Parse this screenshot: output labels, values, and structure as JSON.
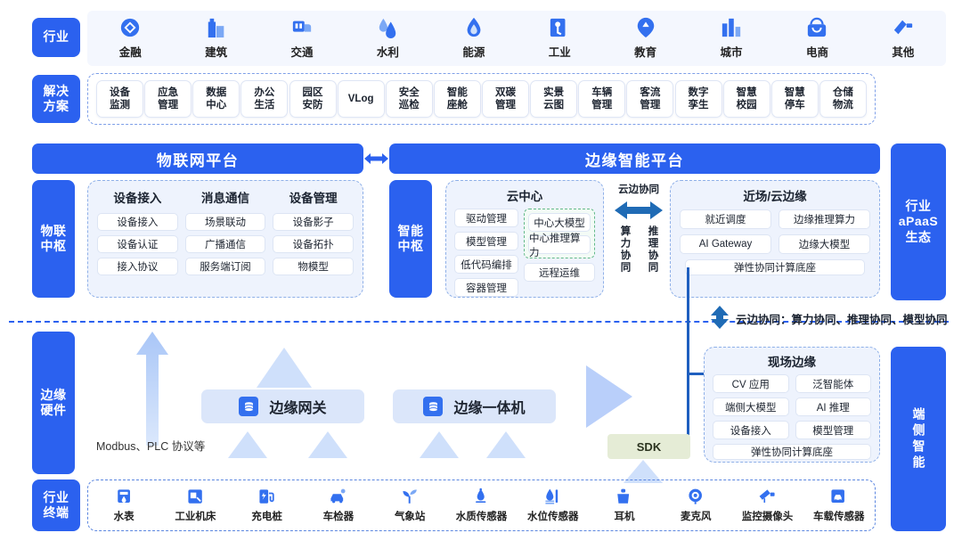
{
  "side_labels": {
    "industry": "行业",
    "solution": "解决\n方案",
    "iot_hub": "物联\n中枢",
    "ai_hub": "智能\n中枢",
    "edge_hardware": "边缘\n硬件",
    "industry_terminal": "行业\n终端",
    "apaas_ecosystem": "行业\naPaaS\n生态",
    "device_intelligence": "端侧智能"
  },
  "industry": {
    "items": [
      {
        "label": "金融",
        "icon": "finance-icon"
      },
      {
        "label": "建筑",
        "icon": "building-icon"
      },
      {
        "label": "交通",
        "icon": "transport-icon"
      },
      {
        "label": "水利",
        "icon": "water-icon"
      },
      {
        "label": "能源",
        "icon": "energy-icon"
      },
      {
        "label": "工业",
        "icon": "industry-icon"
      },
      {
        "label": "教育",
        "icon": "education-icon"
      },
      {
        "label": "城市",
        "icon": "city-icon"
      },
      {
        "label": "电商",
        "icon": "ecommerce-icon"
      },
      {
        "label": "其他",
        "icon": "other-icon"
      }
    ]
  },
  "solutions": {
    "items": [
      "设备\n监测",
      "应急\n管理",
      "数据\n中心",
      "办公\n生活",
      "园区\n安防",
      "VLog",
      "安全\n巡检",
      "智能\n座舱",
      "双碳\n管理",
      "实景\n云图",
      "车辆\n管理",
      "客流\n管理",
      "数字\n孪生",
      "智慧\n校园",
      "智慧\n停车",
      "仓储\n物流"
    ]
  },
  "platforms": {
    "iot": "物联网平台",
    "edge": "边缘智能平台"
  },
  "iot_hub": {
    "columns": [
      {
        "title": "设备接入",
        "items": [
          "设备接入",
          "设备认证",
          "接入协议"
        ]
      },
      {
        "title": "消息通信",
        "items": [
          "场景联动",
          "广播通信",
          "服务端订阅"
        ]
      },
      {
        "title": "设备管理",
        "items": [
          "设备影子",
          "设备拓扑",
          "物模型"
        ]
      }
    ]
  },
  "cloud_center": {
    "title": "云中心",
    "left_items": [
      "驱动管理",
      "模型管理",
      "低代码编排",
      "容器管理"
    ],
    "highlight_items": [
      "中心大模型",
      "中心推理算力"
    ],
    "right_items": [
      "远程运维"
    ]
  },
  "coordination": {
    "header": "云边协同",
    "vertical_left": "算力协同",
    "vertical_right": "推理协同",
    "caption": "云边协同：算力协同、推理协同、模型协同"
  },
  "near_field": {
    "title": "近场/云边缘",
    "rows": [
      [
        "就近调度",
        "边缘推理算力"
      ],
      [
        "AI Gateway",
        "边缘大模型"
      ]
    ],
    "full_row": "弹性协同计算底座"
  },
  "field_edge": {
    "title": "现场边缘",
    "rows": [
      [
        "CV 应用",
        "泛智能体"
      ],
      [
        "端侧大模型",
        "AI 推理"
      ],
      [
        "设备接入",
        "模型管理"
      ]
    ],
    "full_row": "弹性协同计算底座"
  },
  "edge_hardware": {
    "gateway": "边缘网关",
    "all_in_one": "边缘一体机",
    "protocol_note": "Modbus、PLC 协议等",
    "sdk": "SDK"
  },
  "terminals": {
    "items": [
      {
        "label": "水表",
        "icon": "water-meter-icon"
      },
      {
        "label": "工业机床",
        "icon": "machine-tool-icon"
      },
      {
        "label": "充电桩",
        "icon": "charging-pile-icon"
      },
      {
        "label": "车检器",
        "icon": "vehicle-detector-icon"
      },
      {
        "label": "气象站",
        "icon": "weather-station-icon"
      },
      {
        "label": "水质传感器",
        "icon": "water-quality-sensor-icon"
      },
      {
        "label": "水位传感器",
        "icon": "water-level-sensor-icon"
      },
      {
        "label": "耳机",
        "icon": "headphone-icon"
      },
      {
        "label": "麦克风",
        "icon": "microphone-icon"
      },
      {
        "label": "监控摄像头",
        "icon": "cctv-camera-icon"
      },
      {
        "label": "车载传感器",
        "icon": "vehicle-sensor-icon"
      }
    ]
  },
  "colors": {
    "primary_blue": "#2b61ef",
    "icon_blue": "#3370ef",
    "light_panel": "#eef3fd",
    "row_bg": "#f4f7fe",
    "cell_border": "#dde5f4",
    "dashed_border": "#8fb0e8",
    "green_accent": "#63b98a",
    "sdk_bg": "#e5ecd6",
    "arrow_blue": "#1f5fbf"
  }
}
